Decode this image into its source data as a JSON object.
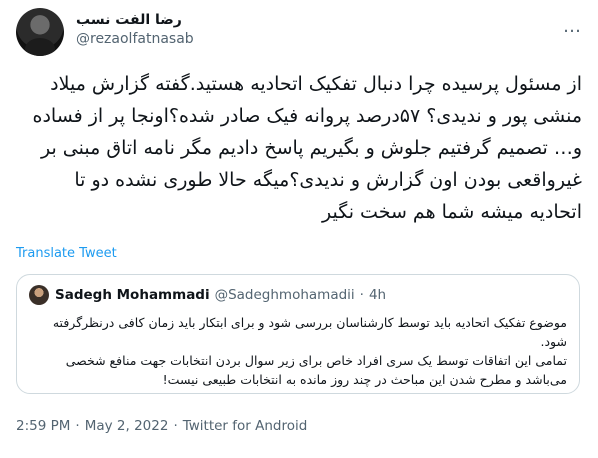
{
  "author": {
    "display_name": "رضا الفت نسب",
    "handle": "@rezaolfatnasab",
    "more_icon": "…"
  },
  "tweet": {
    "text": "از مسئول پرسیده چرا دنبال تفکیک اتحادیه هستید.گفته گزارش میلاد منشی پور و ندیدی؟ ۵۷درصد پروانه فیک صادر شده؟اونجا پر از فساده و… تصمیم گرفتیم جلوش و بگیریم پاسخ دادیم مگر نامه اتاق مبنی بر غیرواقعی بودن اون گزارش و ندیدی؟میگه حالا طوری نشده دو تا اتحادیه میشه شما هم سخت نگیر",
    "translate_label": "Translate Tweet"
  },
  "quote": {
    "name": "Sadegh Mohammadi",
    "handle": "@Sadeghmohamadii",
    "separator": "·",
    "time": "4h",
    "text_line1": "موضوع تفکیک اتحادیه باید توسط کارشناسان بررسی شود و برای ابتکار باید زمان کافی درنظرگرفته شود.",
    "text_line2": "تمامی این اتفاقات توسط یک سری افراد خاص برای زیر سوال بردن انتخابات جهت منافع شخصی می‌باشد و مطرح شدن این مباحث در چند روز مانده به انتخابات طبیعی نیست!"
  },
  "meta": {
    "time": "2:59 PM",
    "date": "May 2, 2022",
    "source": "Twitter for Android",
    "separator": "·"
  }
}
